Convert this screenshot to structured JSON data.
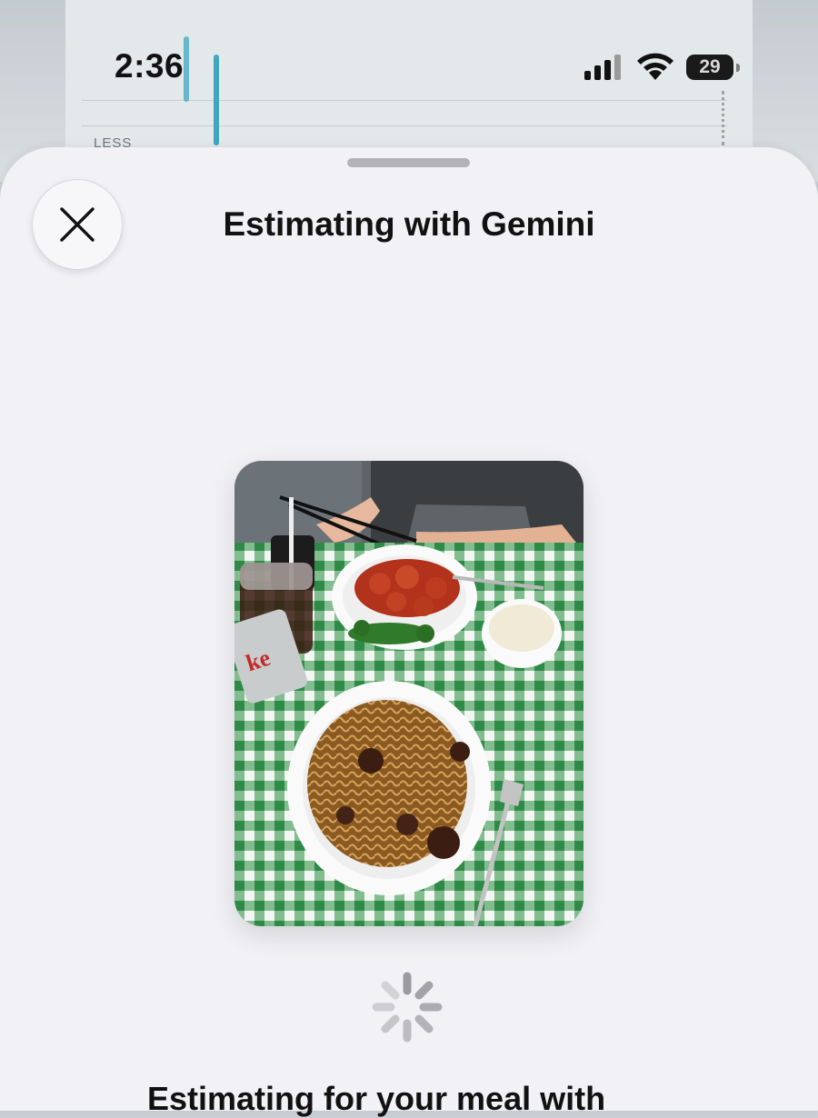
{
  "status_bar": {
    "time": "2:36",
    "battery_level": "29",
    "icons": [
      "signal-icon",
      "wifi-icon",
      "battery-icon"
    ]
  },
  "background_app": {
    "label": "LESS"
  },
  "sheet": {
    "title": "Estimating with Gemini",
    "close_icon": "close-icon",
    "photo_description_icon": "meal-photo",
    "loading_icon": "activity-spinner-icon",
    "bottom_text": "Estimating for your meal with"
  },
  "colors": {
    "sheet_bg": "#f1f1f6",
    "tablecloth_green": "#3f9a56",
    "spinner": "#9a9aa0"
  }
}
